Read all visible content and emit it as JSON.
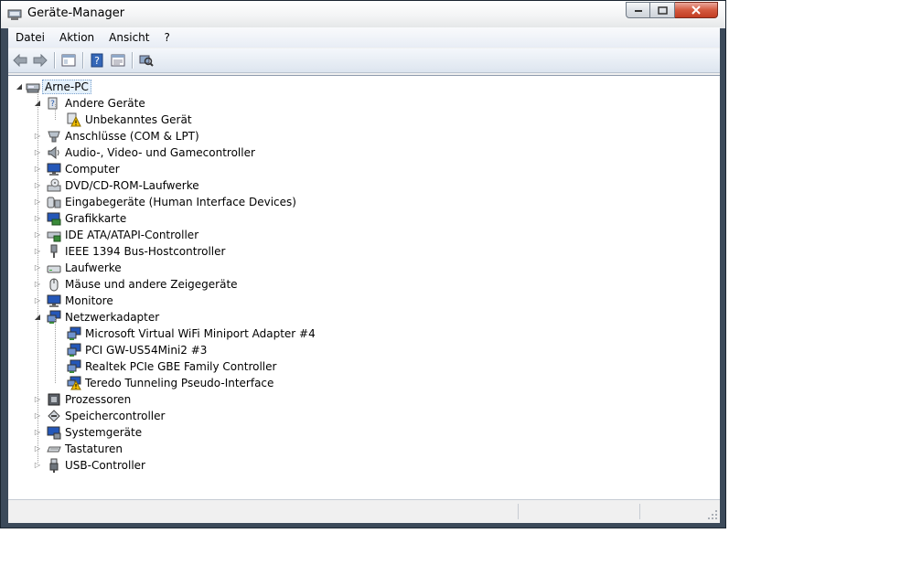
{
  "window": {
    "title": "Geräte-Manager"
  },
  "menu": [
    {
      "label": "Datei"
    },
    {
      "label": "Aktion"
    },
    {
      "label": "Ansicht"
    },
    {
      "label": "?"
    }
  ],
  "toolbar": {
    "icons": [
      "back-arrow-icon",
      "forward-arrow-icon",
      "show-hide-console-tree-icon",
      "help-icon",
      "properties-icon",
      "scan-hardware-icon"
    ]
  },
  "tree": {
    "root": {
      "label": "Arne-PC",
      "icon": "computer-icon"
    },
    "nodes": [
      {
        "label": "Andere Geräte",
        "icon": "unknown-device-icon",
        "expanded": true
      },
      {
        "label": "Unbekanntes Gerät",
        "icon": "warning-device-icon",
        "child": true
      },
      {
        "label": "Anschlüsse (COM & LPT)",
        "icon": "port-icon",
        "expanded": false
      },
      {
        "label": "Audio-, Video- und Gamecontroller",
        "icon": "speaker-icon",
        "expanded": false
      },
      {
        "label": "Computer",
        "icon": "monitor-icon",
        "expanded": false
      },
      {
        "label": "DVD/CD-ROM-Laufwerke",
        "icon": "dvd-drive-icon",
        "expanded": false
      },
      {
        "label": "Eingabegeräte (Human Interface Devices)",
        "icon": "hid-icon",
        "expanded": false
      },
      {
        "label": "Grafikkarte",
        "icon": "display-adapter-icon",
        "expanded": false
      },
      {
        "label": "IDE ATA/ATAPI-Controller",
        "icon": "ide-controller-icon",
        "expanded": false
      },
      {
        "label": "IEEE 1394 Bus-Hostcontroller",
        "icon": "firewire-icon",
        "expanded": false
      },
      {
        "label": "Laufwerke",
        "icon": "disk-drive-icon",
        "expanded": false
      },
      {
        "label": "Mäuse und andere Zeigegeräte",
        "icon": "mouse-icon",
        "expanded": false
      },
      {
        "label": "Monitore",
        "icon": "monitor-icon",
        "expanded": false
      },
      {
        "label": "Netzwerkadapter",
        "icon": "network-adapter-icon",
        "expanded": true
      },
      {
        "label": "Microsoft Virtual WiFi Miniport Adapter #4",
        "icon": "network-adapter-icon",
        "child": true
      },
      {
        "label": "PCI GW-US54Mini2 #3",
        "icon": "network-adapter-icon",
        "child": true
      },
      {
        "label": "Realtek PCIe GBE Family Controller",
        "icon": "network-adapter-icon",
        "child": true
      },
      {
        "label": "Teredo Tunneling Pseudo-Interface",
        "icon": "network-adapter-warning-icon",
        "child": true
      },
      {
        "label": "Prozessoren",
        "icon": "processor-icon",
        "expanded": false
      },
      {
        "label": "Speichercontroller",
        "icon": "storage-controller-icon",
        "expanded": false
      },
      {
        "label": "Systemgeräte",
        "icon": "system-devices-icon",
        "expanded": false
      },
      {
        "label": "Tastaturen",
        "icon": "keyboard-icon",
        "expanded": false
      },
      {
        "label": "USB-Controller",
        "icon": "usb-icon",
        "expanded": false
      }
    ]
  }
}
